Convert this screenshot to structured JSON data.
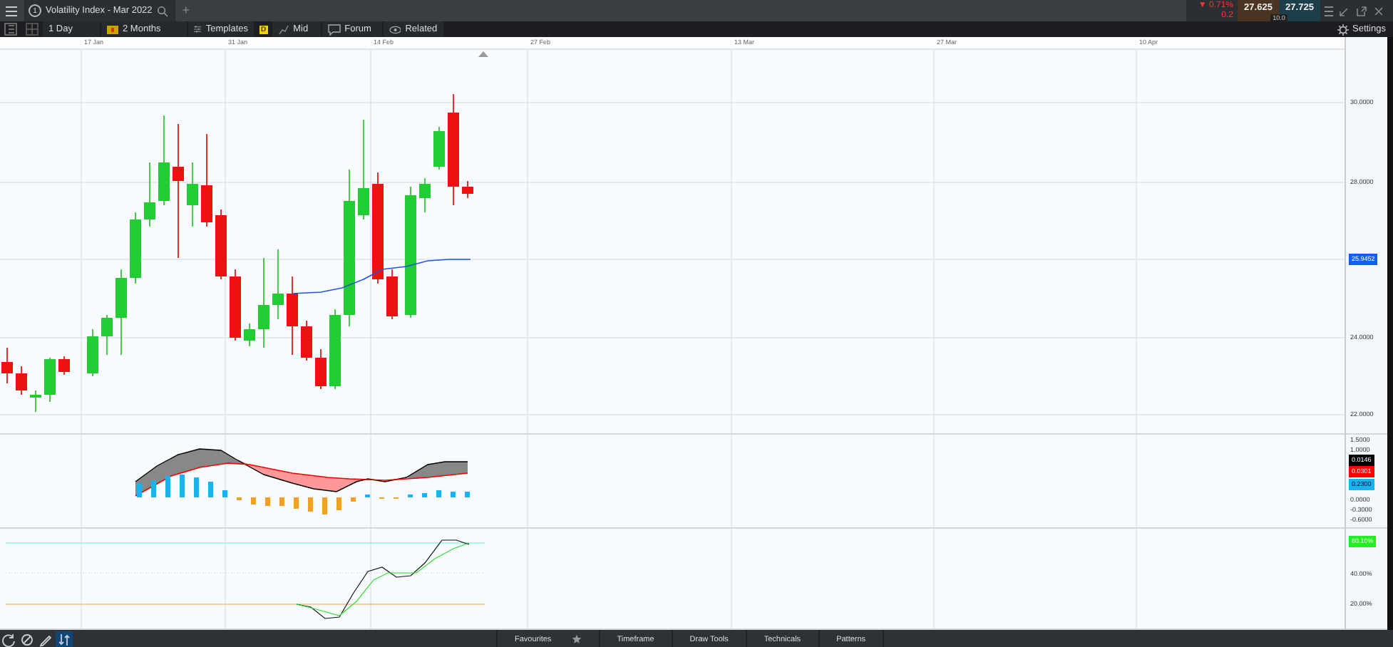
{
  "window": {
    "tab_number": "1",
    "title": "Volatility Index - Mar 2022",
    "add_tab": "+"
  },
  "quote": {
    "change": "▼ 0.71%",
    "change_points": "0.2",
    "sell": "27.625",
    "buy": "27.725",
    "spread": "10.0"
  },
  "toolbar": {
    "interval": "1 Day",
    "range": "2 Months",
    "templates": "Templates",
    "price_type_badge": "D",
    "price_type": "Mid",
    "forum": "Forum",
    "related": "Related",
    "settings": "Settings"
  },
  "date_axis": [
    "17 Jan",
    "31 Jan",
    "14 Feb",
    "27 Feb",
    "13 Mar",
    "27 Mar",
    "10 Apr"
  ],
  "price_axis": {
    "ticks": [
      "30.0000",
      "28.0000",
      "24.0000",
      "22.0000"
    ],
    "current": "25.9452"
  },
  "macd_axis": {
    "ticks": [
      "1.5000",
      "1.0000",
      "0.0000",
      "-0.3000",
      "-0.6000"
    ],
    "tags": [
      {
        "label": "0.0146",
        "color": "#000000"
      },
      {
        "label": "0.0301",
        "color": "#ff0000"
      },
      {
        "label": "0.2300",
        "color": "#1ab2f0"
      }
    ]
  },
  "stoch_axis": {
    "ticks": [
      "40.00%",
      "20.00%"
    ],
    "tag": "80.10%"
  },
  "bottom_tools": [
    {
      "kind": "refresh",
      "selected": false
    },
    {
      "kind": "ban",
      "selected": false
    },
    {
      "kind": "pencil",
      "selected": false
    },
    {
      "kind": "arrows",
      "selected": true
    }
  ],
  "bottom_panels": [
    {
      "label": "Favourites",
      "kind": "favourites"
    },
    {
      "label": "Timeframe",
      "kind": "panel"
    },
    {
      "label": "Draw Tools",
      "kind": "panel"
    },
    {
      "label": "Technicals",
      "kind": "panel"
    },
    {
      "label": "Patterns",
      "kind": "panel"
    }
  ]
}
